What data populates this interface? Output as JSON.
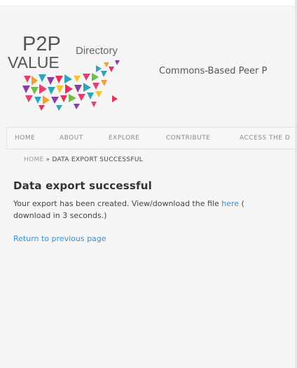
{
  "logo": {
    "line1": "P2P",
    "line2": "VALUE",
    "directory": "Directory"
  },
  "site": {
    "tagline": "Commons-Based Peer P"
  },
  "nav": {
    "items": [
      "HOME",
      "ABOUT",
      "EXPLORE",
      "CONTRIBUTE",
      "ACCESS THE D"
    ]
  },
  "breadcrumb": {
    "home": "HOME",
    "separator": "»",
    "current": "DATA EXPORT SUCCESSFUL"
  },
  "main": {
    "title": "Data export successful",
    "message_before_link": "Your export has been created. View/download the file ",
    "link_label": "here",
    "message_after_link": " (",
    "message_line2": "download in 3 seconds.)",
    "return_link": "Return to previous page"
  },
  "colors": {
    "link": "#3a8fd6",
    "text": "#444444",
    "background": "#f5f5f5"
  }
}
